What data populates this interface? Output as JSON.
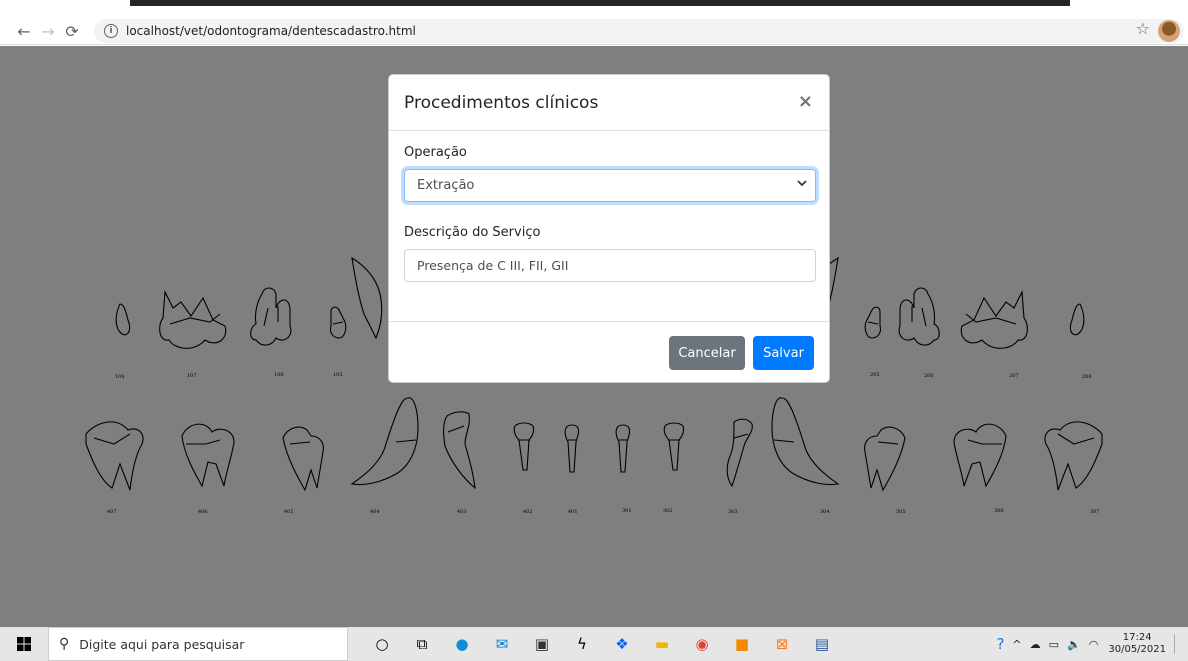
{
  "browser": {
    "url": "localhost/vet/odontograma/dentescadastro.html"
  },
  "chart_teeth": {
    "upper_labels": [
      "108",
      "107",
      "106",
      "105",
      "205",
      "206",
      "207",
      "208"
    ],
    "lower_labels": [
      "407",
      "406",
      "405",
      "404",
      "403",
      "402",
      "401",
      "301",
      "302",
      "303",
      "304",
      "305",
      "306",
      "307"
    ]
  },
  "modal": {
    "title": "Procedimentos clínicos",
    "close_symbol": "×",
    "operacao_label": "Operação",
    "operacao_value": "Extração",
    "descricao_label": "Descrição do Serviço",
    "descricao_value": "Presença de C III, FII, GII",
    "cancel_label": "Cancelar",
    "save_label": "Salvar"
  },
  "taskbar": {
    "search_placeholder": "Digite aqui para pesquisar",
    "time": "17:24",
    "date": "30/05/2021"
  },
  "colors": {
    "primary": "#007bff",
    "secondary": "#6c757d"
  }
}
